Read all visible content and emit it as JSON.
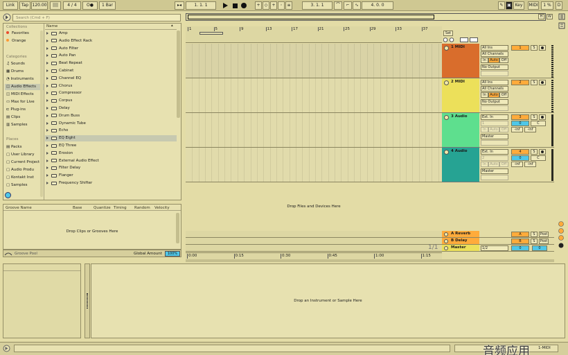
{
  "toolbar": {
    "link": "Link",
    "tap": "Tap",
    "tempo": "120.00",
    "meter": "4 / 4",
    "quant": "1 Bar",
    "position": "1.   1.   1",
    "loop_start": "3.   1.   1",
    "loop_len": "4.   0.   0",
    "key": "Key",
    "midi": "MIDI",
    "cpu": "1 %",
    "d": "D"
  },
  "search": {
    "placeholder": "Search (Cmd + F)"
  },
  "browser": {
    "collections_title": "Collections",
    "name_col": "Name",
    "collections": [
      {
        "label": "Favorites",
        "color": "#e94a2d"
      },
      {
        "label": "Orange",
        "color": "#ff9a35"
      }
    ],
    "categories_title": "Categories",
    "categories": [
      "Sounds",
      "Drums",
      "Instruments",
      "Audio Effects",
      "MIDI Effects",
      "Max for Live",
      "Plug-ins",
      "Clips",
      "Samples"
    ],
    "places_title": "Places",
    "places": [
      "Packs",
      "User Library",
      "Current Project",
      "Audio Produ",
      "Kontakt Inst",
      "Samples"
    ],
    "items": [
      "Amp",
      "Audio Effect Rack",
      "Auto Filter",
      "Auto Pan",
      "Beat Repeat",
      "Cabinet",
      "Channel EQ",
      "Chorus",
      "Compressor",
      "Corpus",
      "Delay",
      "Drum Buss",
      "Dynamic Tube",
      "Echo",
      "EQ Eight",
      "EQ Three",
      "Erosion",
      "External Audio Effect",
      "Filter Delay",
      "Flanger",
      "Frequency Shifter"
    ],
    "selected": "EQ Eight"
  },
  "groove": {
    "cols": [
      "Groove Name",
      "Base",
      "Quantize",
      "Timing",
      "Random",
      "Velocity"
    ],
    "drop": "Drop Clips or Grooves Here",
    "pool": "Groove Pool",
    "global": "Global Amount",
    "amount": "100%"
  },
  "arrangement": {
    "bars": [
      "1",
      "5",
      "9",
      "13",
      "17",
      "21",
      "25",
      "29",
      "33",
      "37"
    ],
    "set": "Set",
    "drop": "Drop Files and Devices Here",
    "times": [
      "0:00",
      "0:15",
      "0:30",
      "0:45",
      "1:00",
      "1:15"
    ],
    "zoom": "1/1",
    "hw": [
      "H",
      "W"
    ]
  },
  "tracks": [
    {
      "name": "1 MIDI",
      "num": "1",
      "color": "#d96d2c",
      "clip": "#d9d3a6",
      "in1": "All Ins",
      "in2": "All Channels",
      "out": "No Output",
      "midi": true
    },
    {
      "name": "2 MIDI",
      "num": "2",
      "color": "#ece05a",
      "clip": "#e1dbab",
      "in1": "All Ins",
      "in2": "All Channels",
      "out": "No Output",
      "midi": true
    },
    {
      "name": "3 Audio",
      "num": "3",
      "color": "#5edf8e",
      "clip": "#e1dbab",
      "in1": "Ext. In",
      "in2": "1",
      "out": "Master",
      "midi": false,
      "vol": "0",
      "pan": "C",
      "s1": "-inf",
      "s2": "-inf"
    },
    {
      "name": "4 Audio",
      "num": "4",
      "color": "#26a393",
      "clip": "#e1dbab",
      "in1": "Ext. In",
      "in2": "2",
      "out": "Master",
      "midi": false,
      "vol": "0",
      "pan": "C",
      "s1": "-inf",
      "s2": "-inf"
    }
  ],
  "monitor": {
    "in": "In",
    "auto": "Auto",
    "off": "Off",
    "s": "S",
    "post": "Post"
  },
  "returns": [
    {
      "name": "A Reverb",
      "color": "#ffab3b",
      "btn": "A",
      "bcol": "org"
    },
    {
      "name": "B Delay",
      "color": "#ffab3b",
      "btn": "B",
      "bcol": "org"
    },
    {
      "name": "Master",
      "color": "#ece05a",
      "btn": "0",
      "bcol": "cyn",
      "extra": "1/2"
    }
  ],
  "device": {
    "drop": "Drop an Instrument or Sample Here"
  },
  "status": {
    "track": "1-MIDI",
    "watermark": "音频应用"
  }
}
